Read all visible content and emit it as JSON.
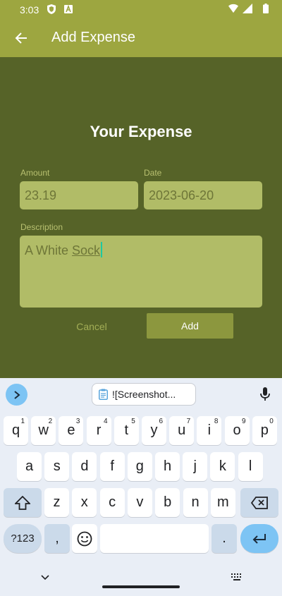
{
  "status_bar": {
    "time": "3:03"
  },
  "app_bar": {
    "title": "Add Expense"
  },
  "form": {
    "title": "Your Expense",
    "amount_label": "Amount",
    "amount_value": "23.19",
    "date_label": "Date",
    "date_value": "2023-06-20",
    "description_label": "Description",
    "description_prefix": "A White ",
    "description_current_word": "Sock",
    "cancel_label": "Cancel",
    "add_label": "Add"
  },
  "keyboard": {
    "clipboard_chip": "![Screenshot...",
    "row1": [
      {
        "k": "q",
        "h": "1"
      },
      {
        "k": "w",
        "h": "2"
      },
      {
        "k": "e",
        "h": "3"
      },
      {
        "k": "r",
        "h": "4"
      },
      {
        "k": "t",
        "h": "5"
      },
      {
        "k": "y",
        "h": "6"
      },
      {
        "k": "u",
        "h": "7"
      },
      {
        "k": "i",
        "h": "8"
      },
      {
        "k": "o",
        "h": "9"
      },
      {
        "k": "p",
        "h": "0"
      }
    ],
    "row2": [
      "a",
      "s",
      "d",
      "f",
      "g",
      "h",
      "j",
      "k",
      "l"
    ],
    "row3": [
      "z",
      "x",
      "c",
      "v",
      "b",
      "n",
      "m"
    ],
    "symbols_label": "?123",
    "comma": ",",
    "period": "."
  },
  "colors": {
    "app_bar": "#9da640",
    "background": "#566328",
    "field": "#b1bc67",
    "add_button": "#8c973e",
    "accent_blue": "#7dc4f4"
  },
  "icons": [
    "back-arrow-icon",
    "shield-icon",
    "a-box-icon",
    "wifi-icon",
    "signal-icon",
    "battery-icon",
    "chevron-right-icon",
    "clipboard-icon",
    "mic-icon",
    "shift-icon",
    "backspace-icon",
    "emoji-icon",
    "enter-icon",
    "chevron-down-icon",
    "keyboard-grid-icon"
  ]
}
